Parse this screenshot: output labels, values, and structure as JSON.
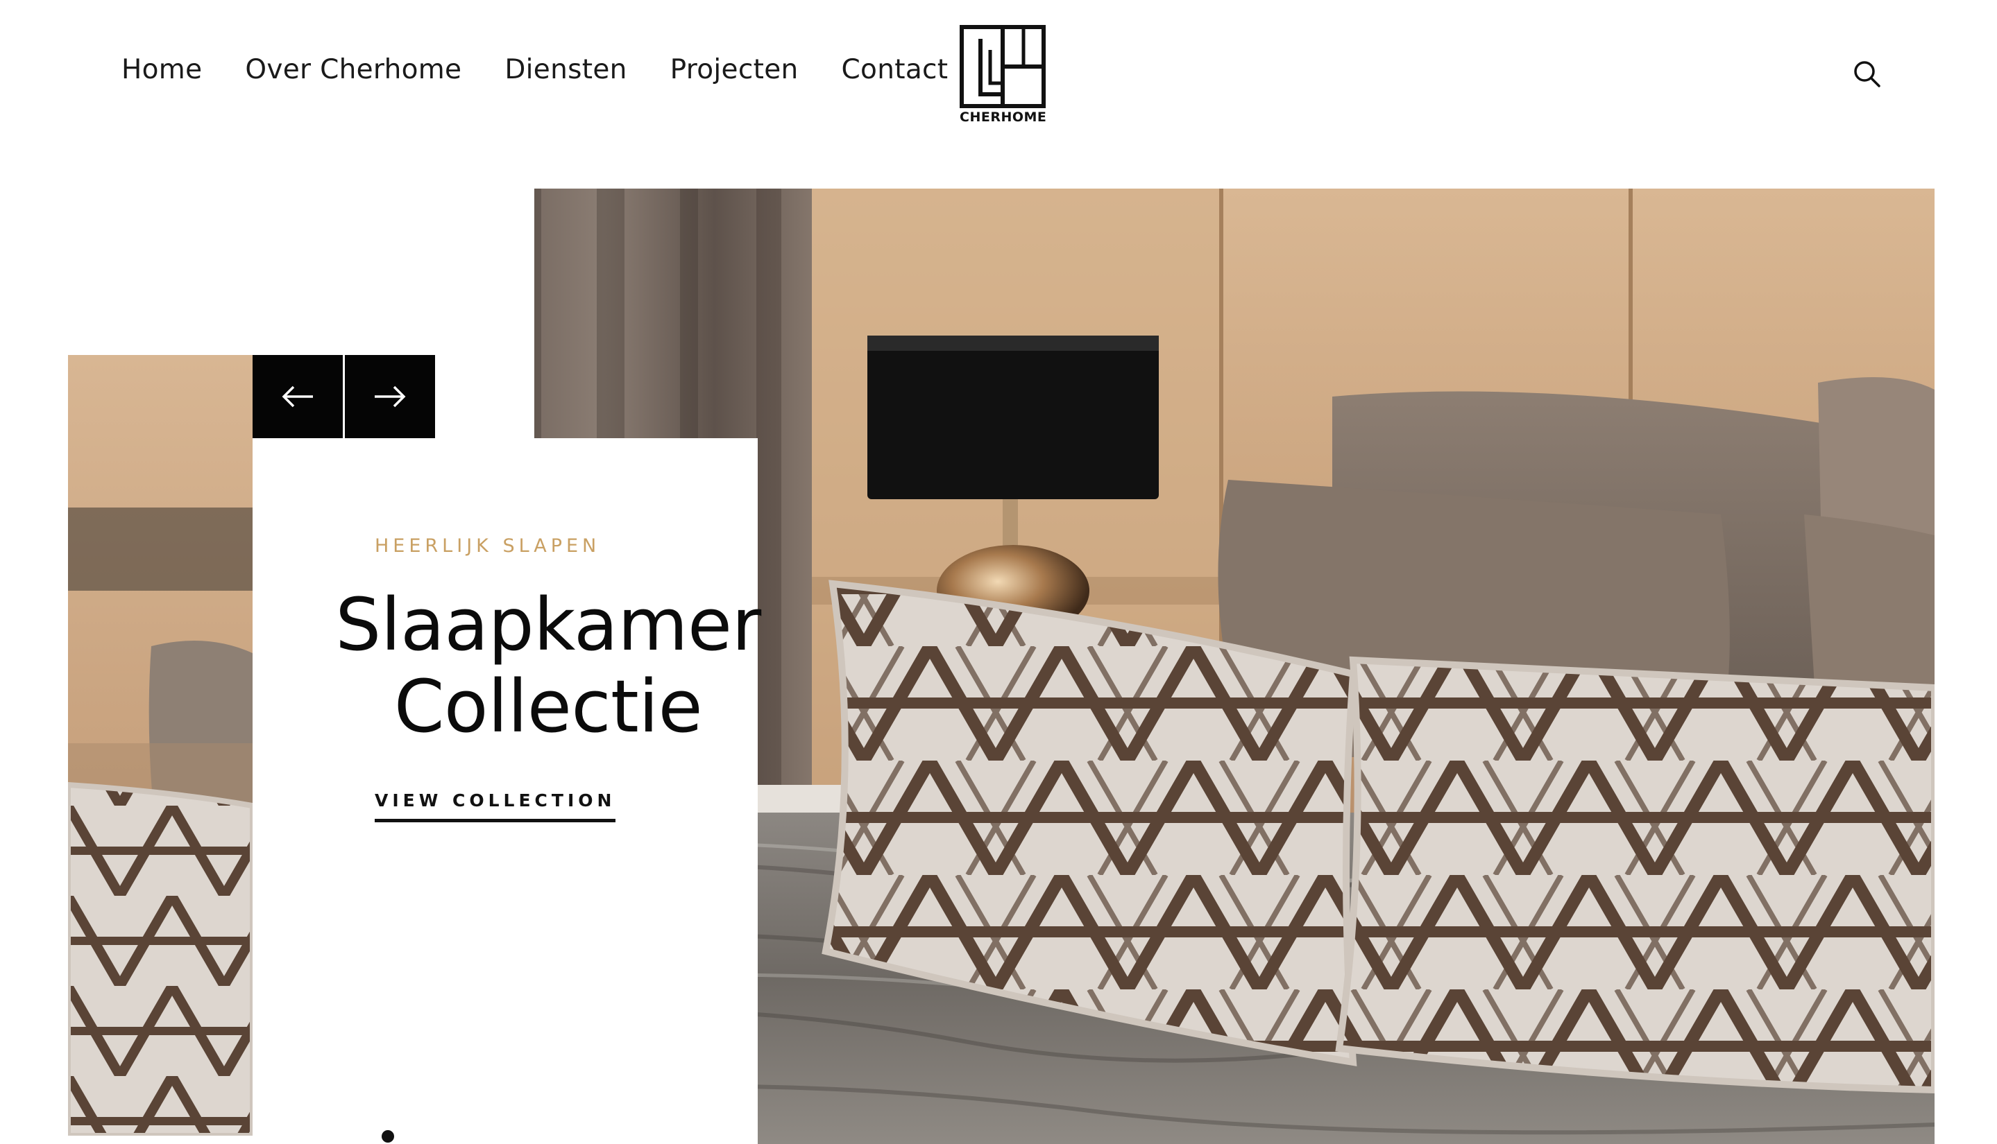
{
  "nav": {
    "items": [
      {
        "label": "Home"
      },
      {
        "label": "Over Cherhome"
      },
      {
        "label": "Diensten"
      },
      {
        "label": "Projecten"
      },
      {
        "label": "Contact"
      }
    ]
  },
  "logo": {
    "text": "CHERHOME"
  },
  "header": {
    "search_icon": "search-icon"
  },
  "slider": {
    "prev_icon": "arrow-left-icon",
    "next_icon": "arrow-right-icon",
    "eyebrow": "HEERLIJK SLAPEN",
    "title_line1": "Slaapkamer",
    "title_line2": "Collectie",
    "cta_label": "VIEW COLLECTION",
    "pagination": {
      "current": 1
    }
  },
  "colors": {
    "accent": "#c9a063",
    "text": "#111111",
    "button_bg": "#050505",
    "background": "#ffffff"
  }
}
